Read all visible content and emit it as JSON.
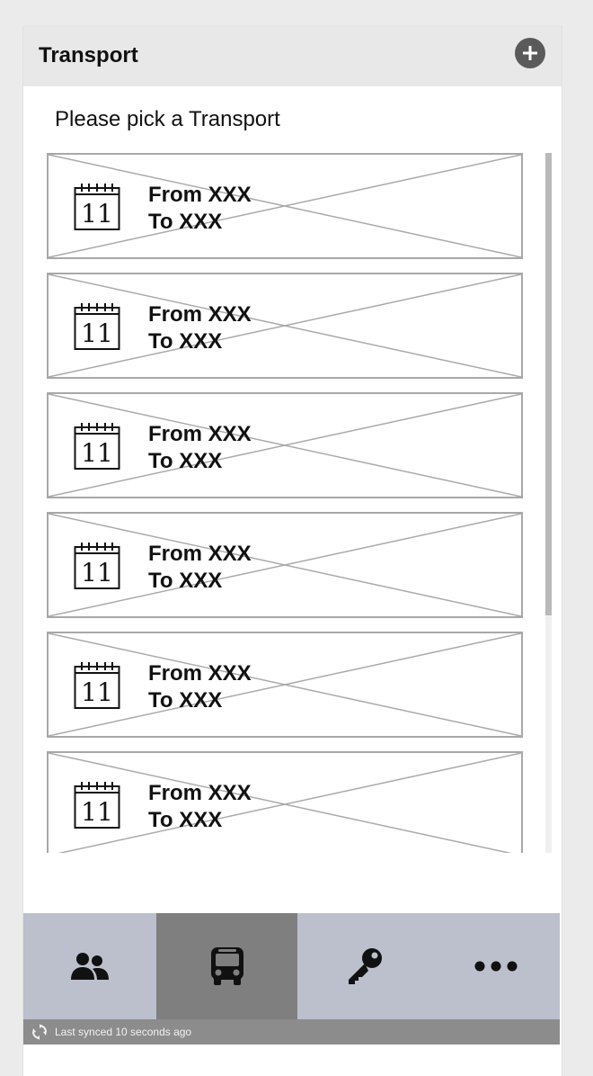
{
  "header": {
    "title": "Transport",
    "add_icon": "plus-circle-icon"
  },
  "prompt": "Please pick a Transport",
  "transports": [
    {
      "from": "From XXX",
      "to": "To XXX",
      "icon": "calendar-icon",
      "day": "11"
    },
    {
      "from": "From XXX",
      "to": "To XXX",
      "icon": "calendar-icon",
      "day": "11"
    },
    {
      "from": "From XXX",
      "to": "To XXX",
      "icon": "calendar-icon",
      "day": "11"
    },
    {
      "from": "From XXX",
      "to": "To XXX",
      "icon": "calendar-icon",
      "day": "11"
    },
    {
      "from": "From XXX",
      "to": "To XXX",
      "icon": "calendar-icon",
      "day": "11"
    },
    {
      "from": "From XXX",
      "to": "To XXX",
      "icon": "calendar-icon",
      "day": "11"
    }
  ],
  "nav": {
    "tabs": [
      {
        "id": "people",
        "icon": "people-icon",
        "active": false
      },
      {
        "id": "transport",
        "icon": "bus-icon",
        "active": true
      },
      {
        "id": "keys",
        "icon": "key-icon",
        "active": false
      },
      {
        "id": "more",
        "icon": "more-icon",
        "active": false
      }
    ]
  },
  "sync": {
    "text": "Last synced 10 seconds ago",
    "icon": "sync-icon"
  },
  "colors": {
    "header_bg": "#e8e8e8",
    "nav_bg": "#bcbfcc",
    "nav_active": "#7f7f7f",
    "sync_bar": "#8c8c8c",
    "item_border": "#a8a8a8"
  }
}
